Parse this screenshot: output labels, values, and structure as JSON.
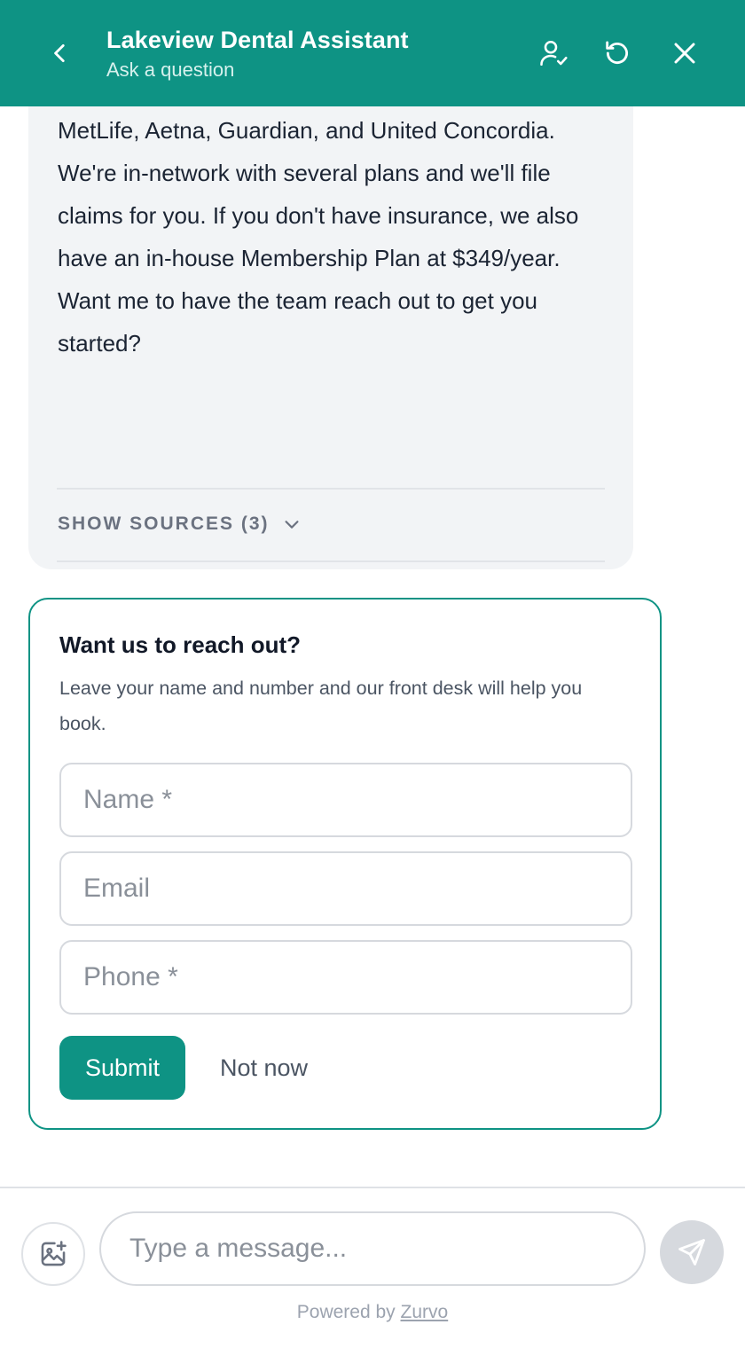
{
  "theme": {
    "accent": "#0e9384",
    "bubble_bg": "#f2f4f6",
    "send_disabled": "#d6d9de"
  },
  "header": {
    "title": "Lakeview Dental Assistant",
    "subtitle": "Ask a question",
    "icons": [
      "chevron-left-icon",
      "user-check-icon",
      "refresh-icon",
      "close-icon"
    ]
  },
  "assistant_message": {
    "text": "MetLife, Aetna, Guardian, and United Concordia. We're in-network with several plans and we'll file claims for you. If you don't have insurance, we also have an in-house Membership Plan at $349/year. Want me to have the team reach out to get you started?",
    "sources_label": "SHOW SOURCES (3)"
  },
  "lead_form": {
    "title": "Want us to reach out?",
    "description": "Leave your name and number and our front desk will help you book.",
    "fields": {
      "name": {
        "placeholder": "Name *",
        "value": ""
      },
      "email": {
        "placeholder": "Email",
        "value": ""
      },
      "phone": {
        "placeholder": "Phone *",
        "value": ""
      }
    },
    "submit_label": "Submit",
    "dismiss_label": "Not now"
  },
  "composer": {
    "placeholder": "Type a message...",
    "value": "",
    "icons": [
      "image-add-icon",
      "send-icon"
    ]
  },
  "footer": {
    "powered_prefix": "Powered by ",
    "brand": "Zurvo"
  }
}
